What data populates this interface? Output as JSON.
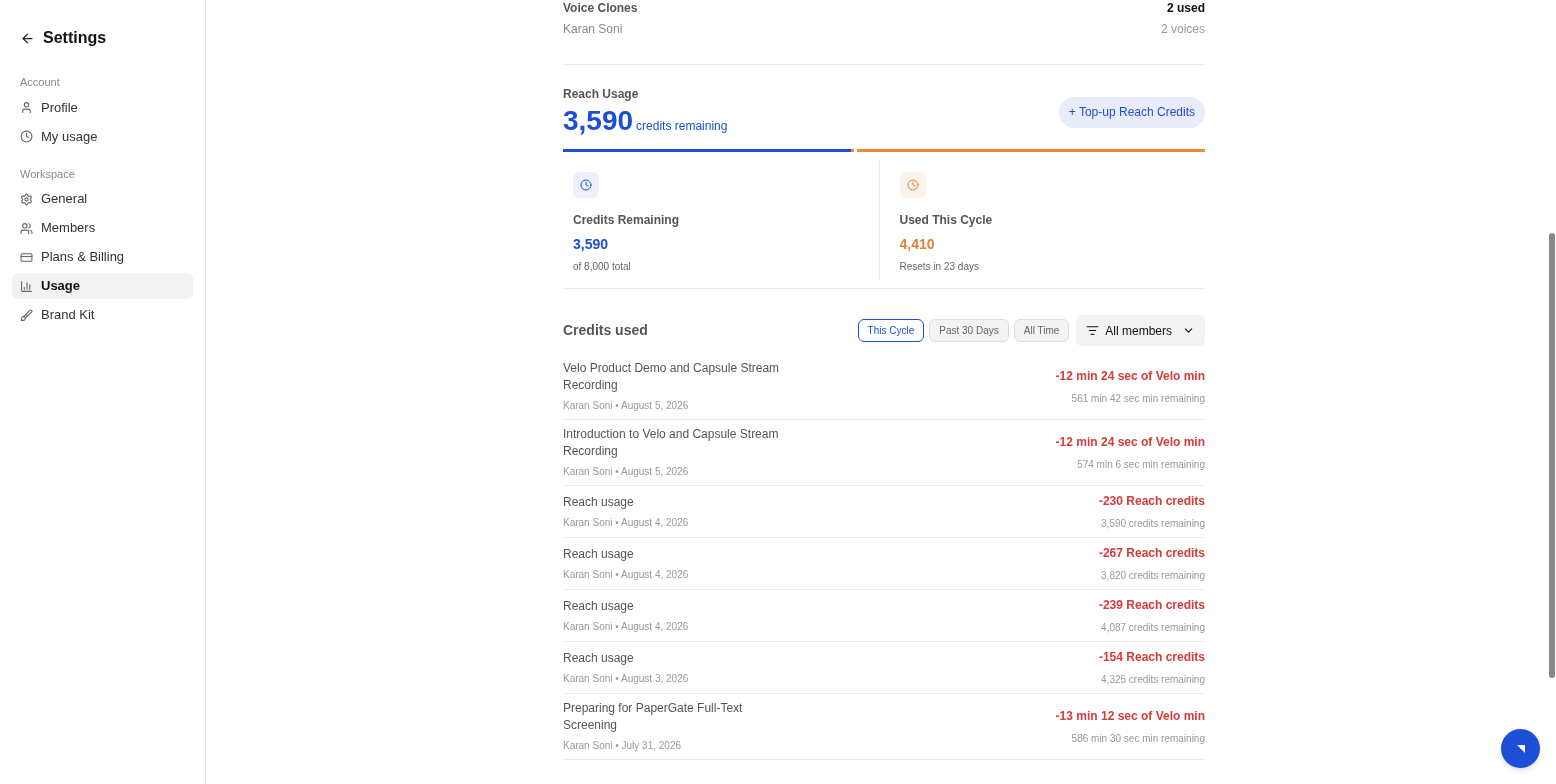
{
  "sidebar": {
    "title": "Settings",
    "sections": [
      {
        "heading": "Account",
        "items": [
          {
            "kind": "user",
            "label": "Profile",
            "selected": false
          },
          {
            "kind": "clock",
            "label": "My usage",
            "selected": false
          }
        ]
      },
      {
        "heading": "Workspace",
        "items": [
          {
            "kind": "gear",
            "label": "General",
            "selected": false
          },
          {
            "kind": "users",
            "label": "Members",
            "selected": false
          },
          {
            "kind": "card",
            "label": "Plans & Billing",
            "selected": false
          },
          {
            "kind": "chart",
            "label": "Usage",
            "selected": true
          },
          {
            "kind": "brush",
            "label": "Brand Kit",
            "selected": false
          }
        ]
      }
    ]
  },
  "voice_clones": {
    "title": "Voice Clones",
    "subtitle": "Karan Soni",
    "used": "2 used",
    "count": "2 voices"
  },
  "reach_usage": {
    "title": "Reach Usage",
    "amount": "3,590",
    "amount_label": "credits remaining",
    "button": "+ Top-up Reach Credits",
    "level": 0.449,
    "stats": [
      {
        "kind": "remaining",
        "label": "Credits Remaining",
        "value": "3,590",
        "note": "of 8,000 total"
      },
      {
        "kind": "used",
        "label": "Used This Cycle",
        "value": "4,410",
        "note": "Resets in 23 days"
      }
    ]
  },
  "credits_used": {
    "title": "Credits used",
    "filters": [
      {
        "label": "This Cycle",
        "selected": true
      },
      {
        "label": "Past 30 Days",
        "selected": false
      },
      {
        "label": "All Time",
        "selected": false
      }
    ],
    "member_filter": "All members",
    "rows": [
      {
        "title": "Velo Product Demo and Capsule Stream Recording",
        "meta": "Karan Soni • August 5, 2026",
        "amount": "-12 min 24 sec of Velo min",
        "remaining": "561 min 42 sec min remaining"
      },
      {
        "title": "Introduction to Velo and Capsule Stream Recording",
        "meta": "Karan Soni • August 5, 2026",
        "amount": "-12 min 24 sec of Velo min",
        "remaining": "574 min 6 sec min remaining"
      },
      {
        "title": "Reach usage",
        "meta": "Karan Soni • August 4, 2026",
        "amount": "-230 Reach credits",
        "remaining": "3,590 credits remaining"
      },
      {
        "title": "Reach usage",
        "meta": "Karan Soni • August 4, 2026",
        "amount": "-267 Reach credits",
        "remaining": "3,820 credits remaining"
      },
      {
        "title": "Reach usage",
        "meta": "Karan Soni • August 4, 2026",
        "amount": "-239 Reach credits",
        "remaining": "4,087 credits remaining"
      },
      {
        "title": "Reach usage",
        "meta": "Karan Soni • August 3, 2026",
        "amount": "-154 Reach credits",
        "remaining": "4,325 credits remaining"
      },
      {
        "title": "Preparing for PaperGate Full-Text Screening",
        "meta": "Karan Soni • July 31, 2026",
        "amount": "-13 min 12 sec of Velo min",
        "remaining": "586 min 30 sec min remaining"
      }
    ]
  }
}
